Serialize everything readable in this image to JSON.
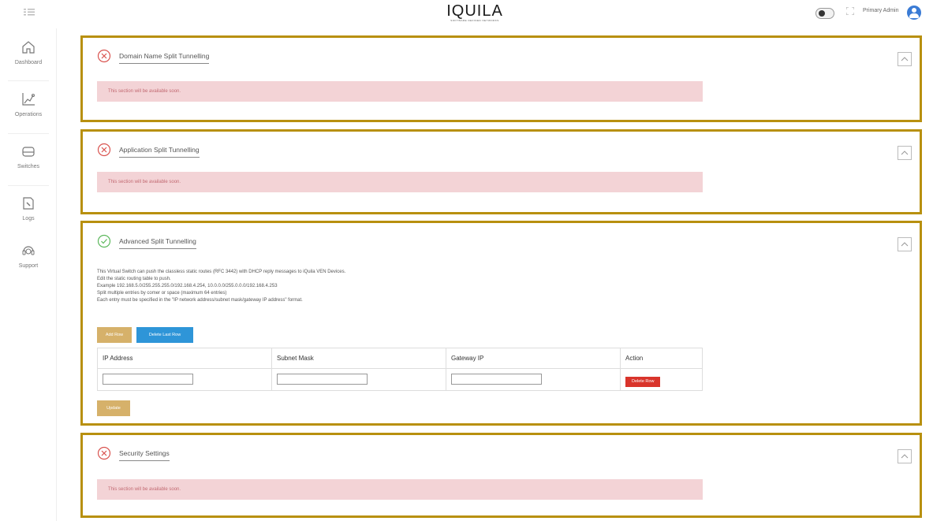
{
  "header": {
    "logo": "IQUILA",
    "logo_tagline": "SOFTWARE DEFINED NETWORKS",
    "admin_name": "Primary Admin"
  },
  "sidebar": {
    "items": [
      {
        "label": "Dashboard",
        "icon": "home-icon"
      },
      {
        "label": "Operations",
        "icon": "chart-icon"
      },
      {
        "label": "Switches",
        "icon": "switch-icon"
      },
      {
        "label": "Logs",
        "icon": "logs-icon"
      },
      {
        "label": "Support",
        "icon": "headset-icon"
      }
    ]
  },
  "panels": {
    "domain": {
      "title": "Domain Name Split Tunnelling",
      "status": "error",
      "notice": "This section will be available soon."
    },
    "application": {
      "title": "Application Split Tunnelling",
      "status": "error",
      "notice": "This section will be available soon."
    },
    "advanced": {
      "title": "Advanced Split Tunnelling",
      "status": "success",
      "desc": [
        "This Virtual Switch can push the classless static routes (RFC 3442) with DHCP reply messages to iQuila VEN Devices.",
        "Edit the static routing table to push.",
        "Example 192.168.5.0/255.255.255.0/192.168.4.254, 10.0.0.0/255.0.0.0/192.168.4.253",
        "Split multiple entries by comer or space (maximum 64 entries)",
        "Each entry must be specified in the \"IP network address/subnet mask/gateway IP address\" format."
      ],
      "add_row_label": "Add Row",
      "delete_last_row_label": "Delete Last Row",
      "table": {
        "headers": [
          "IP Address",
          "Subnet Mask",
          "Gateway IP",
          "Action"
        ],
        "rows": [
          {
            "ip": "",
            "mask": "",
            "gateway": "",
            "action": "Delete Row"
          }
        ]
      },
      "update_label": "Update"
    },
    "security": {
      "title": "Security Settings",
      "status": "error",
      "notice": "This section will be available soon."
    }
  },
  "colors": {
    "panel_border": "#b8900f",
    "error": "#d9534f",
    "success": "#5cb85c",
    "notice_bg": "#f3d3d6",
    "gold_button": "#d6b16a",
    "blue_button": "#2e95d8",
    "red_button": "#d9342b"
  }
}
